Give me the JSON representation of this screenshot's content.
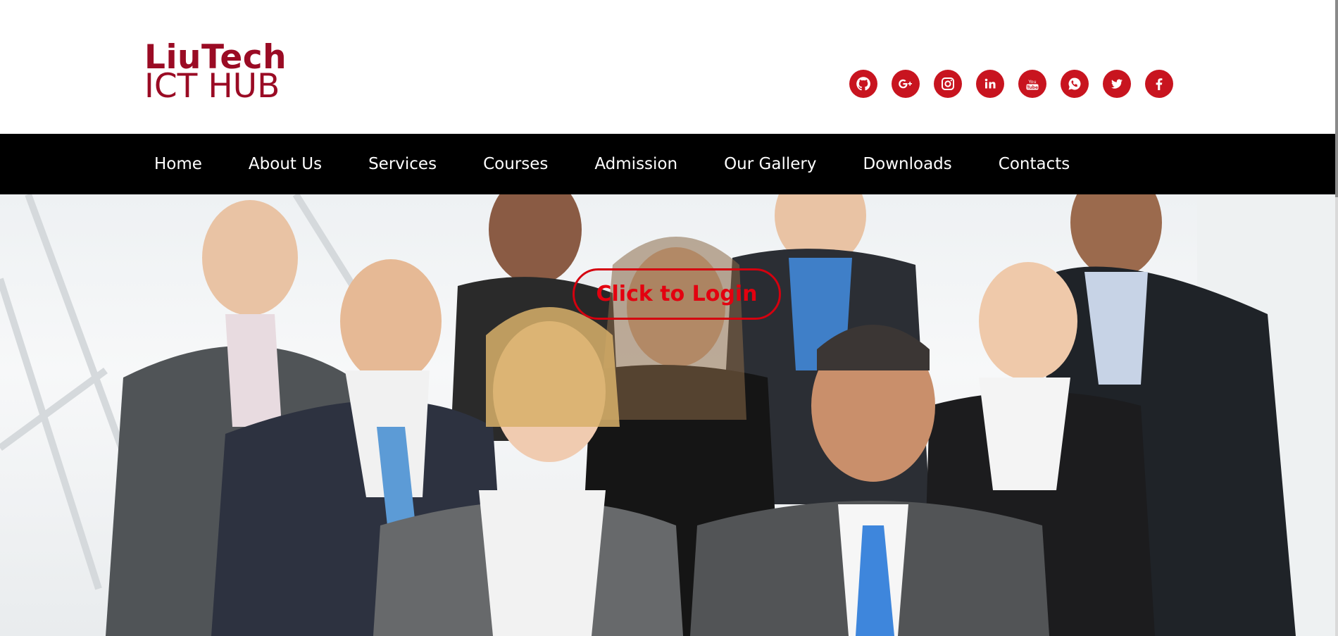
{
  "logo": {
    "line1": "LiuTech",
    "line2": "ICT HUB"
  },
  "social": [
    {
      "name": "github-icon"
    },
    {
      "name": "google-plus-icon"
    },
    {
      "name": "instagram-icon"
    },
    {
      "name": "linkedin-icon"
    },
    {
      "name": "youtube-icon"
    },
    {
      "name": "whatsapp-icon"
    },
    {
      "name": "twitter-icon"
    },
    {
      "name": "facebook-icon"
    }
  ],
  "nav": {
    "items": [
      "Home",
      "About Us",
      "Services",
      "Courses",
      "Admission",
      "Our Gallery",
      "Downloads",
      "Contacts"
    ]
  },
  "hero": {
    "login_label": "Click to Login"
  },
  "colors": {
    "brand": "#9a0b24",
    "accent": "#c8141f",
    "nav_bg": "#000000",
    "login_text": "#e3000f"
  }
}
